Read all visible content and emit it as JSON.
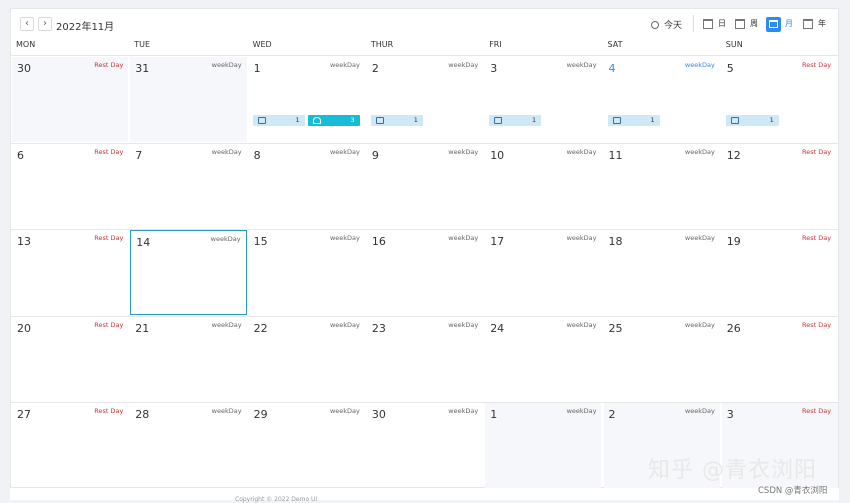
{
  "toolbar": {
    "prev_icon": "‹",
    "next_icon": "›",
    "month_title": "2022年11月",
    "today_label": "今天",
    "views": [
      {
        "label": "日",
        "icon": "day-view-icon"
      },
      {
        "label": "周",
        "icon": "week-view-icon"
      },
      {
        "label": "月",
        "icon": "month-view-icon",
        "active": true
      },
      {
        "label": "年",
        "icon": "year-view-icon"
      }
    ]
  },
  "weekdays": [
    "MON",
    "TUE",
    "WED",
    "THUR",
    "FRI",
    "SAT",
    "SUN"
  ],
  "colors": {
    "accent": "#2d8cf0",
    "rest": "#c8333b",
    "badge_light": "#cfe8f7",
    "badge_teal": "#18bcd6",
    "selected_border": "#2d9bb8"
  },
  "weeks": [
    [
      {
        "day": "30",
        "tag": "Rest Day",
        "type": "rest",
        "gray": true
      },
      {
        "day": "31",
        "tag": "weekDay",
        "type": "work",
        "gray": true
      },
      {
        "day": "1",
        "tag": "weekDay",
        "type": "work",
        "badges": [
          {
            "icon": "briefcase-icon",
            "count": "1"
          },
          {
            "icon": "person-icon",
            "count": "3",
            "teal": true
          }
        ]
      },
      {
        "day": "2",
        "tag": "weekDay",
        "type": "work",
        "badges": [
          {
            "icon": "briefcase-icon",
            "count": "1"
          }
        ]
      },
      {
        "day": "3",
        "tag": "weekDay",
        "type": "work",
        "badges": [
          {
            "icon": "briefcase-icon",
            "count": "1"
          }
        ]
      },
      {
        "day": "4",
        "tag": "weekDay",
        "type": "blue",
        "badges": [
          {
            "icon": "briefcase-icon",
            "count": "1"
          }
        ]
      },
      {
        "day": "5",
        "tag": "Rest Day",
        "type": "rest",
        "badges": [
          {
            "icon": "briefcase-icon",
            "count": "1"
          }
        ]
      }
    ],
    [
      {
        "day": "6",
        "tag": "Rest Day",
        "type": "rest"
      },
      {
        "day": "7",
        "tag": "weekDay",
        "type": "work"
      },
      {
        "day": "8",
        "tag": "weekDay",
        "type": "work"
      },
      {
        "day": "9",
        "tag": "weekDay",
        "type": "work"
      },
      {
        "day": "10",
        "tag": "weekDay",
        "type": "work"
      },
      {
        "day": "11",
        "tag": "weekDay",
        "type": "work"
      },
      {
        "day": "12",
        "tag": "Rest Day",
        "type": "rest"
      }
    ],
    [
      {
        "day": "13",
        "tag": "Rest Day",
        "type": "rest"
      },
      {
        "day": "14",
        "tag": "weekDay",
        "type": "work",
        "selected": true
      },
      {
        "day": "15",
        "tag": "weekDay",
        "type": "work"
      },
      {
        "day": "16",
        "tag": "weekDay",
        "type": "work"
      },
      {
        "day": "17",
        "tag": "weekDay",
        "type": "work"
      },
      {
        "day": "18",
        "tag": "weekDay",
        "type": "work"
      },
      {
        "day": "19",
        "tag": "Rest Day",
        "type": "rest"
      }
    ],
    [
      {
        "day": "20",
        "tag": "Rest Day",
        "type": "rest"
      },
      {
        "day": "21",
        "tag": "weekDay",
        "type": "work"
      },
      {
        "day": "22",
        "tag": "weekDay",
        "type": "work"
      },
      {
        "day": "23",
        "tag": "weekDay",
        "type": "work"
      },
      {
        "day": "24",
        "tag": "weekDay",
        "type": "work"
      },
      {
        "day": "25",
        "tag": "weekDay",
        "type": "work"
      },
      {
        "day": "26",
        "tag": "Rest Day",
        "type": "rest"
      }
    ],
    [
      {
        "day": "27",
        "tag": "Rest Day",
        "type": "rest"
      },
      {
        "day": "28",
        "tag": "weekDay",
        "type": "work"
      },
      {
        "day": "29",
        "tag": "weekDay",
        "type": "work"
      },
      {
        "day": "30",
        "tag": "weekDay",
        "type": "work"
      },
      {
        "day": "1",
        "tag": "weekDay",
        "type": "work",
        "gray": true
      },
      {
        "day": "2",
        "tag": "weekDay",
        "type": "work",
        "gray": true
      },
      {
        "day": "3",
        "tag": "Rest Day",
        "type": "rest",
        "gray": true
      }
    ]
  ],
  "footer": "Copyright © 2022 Demo UI",
  "watermark": "知乎 @青衣浏阳",
  "csdn_mark": "CSDN @青衣浏阳"
}
